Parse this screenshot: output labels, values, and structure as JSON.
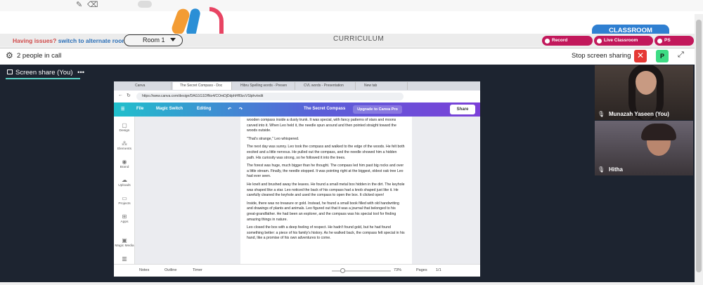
{
  "header": {
    "issue_text": "Having issues?",
    "issue_link": "switch to alternate room",
    "room": "Room 1",
    "curriculum": "CURRICULUM",
    "classroom_tab": "CLASSROOM",
    "pills": [
      "Record Classroom",
      "Live Classroom Support",
      "PS Moments"
    ]
  },
  "call": {
    "people": "2 people in call",
    "stop_share": "Stop screen sharing",
    "avatar_initial": "P",
    "close_symbol": "✕"
  },
  "stage": {
    "share_label": "Screen share (You)",
    "more": "•••"
  },
  "browser": {
    "tabs": [
      "Canva",
      "The Secret Compass - Doc",
      "Hibru Spelling words - Presen",
      "CVL words - Presentation",
      "New tab"
    ],
    "url": "https://www.canva.com/design/DAG1G1DfNo4/COmDjDdphHfI9zcVSlphv/edit"
  },
  "canva": {
    "file": "File",
    "magic_switch": "Magic Switch",
    "editing": "Editing",
    "doc_title": "The Secret Compass",
    "upgrade": "Upgrade to Canva Pro",
    "share": "Share",
    "sidebar": [
      "Design",
      "Elements",
      "Brand",
      "Uploads",
      "Projects",
      "Apps",
      "Magic Media",
      "Charts"
    ],
    "footer": {
      "notes": "Notes",
      "outline": "Outline",
      "timer": "Timer",
      "zoom": "73%",
      "pages": "Pages",
      "page_count": "1/1"
    }
  },
  "document": {
    "paragraphs": [
      "wooden compass inside a dusty trunk. It was special, with fancy patterns of stars and moons carved into it. When Leo held it, the needle spun around and then pointed straight toward the woods outside.",
      "\"That's strange,\" Leo whispered.",
      "The next day was sunny. Leo took the compass and walked to the edge of the woods. He felt both excited and a little nervous. He pulled out the compass, and the needle showed him a hidden path. His curiosity was strong, so he followed it into the trees.",
      "The forest was huge, much bigger than he thought. The compass led him past big rocks and over a little stream. Finally, the needle stopped. It was pointing right at the biggest, oldest oak tree Leo had ever seen.",
      "He knelt and brushed away the leaves. He found a small metal box hidden in the dirt. The keyhole was shaped like a star. Leo noticed the back of his compass had a knob shaped just like it. He carefully cleaned the keyhole and used the compass to open the box. It clicked open!",
      "Inside, there was no treasure or gold. Instead, he found a small book filled with old handwriting and drawings of plants and animals. Leo figured out that it was a journal that belonged to his great-grandfather. He had been an explorer, and the compass was his special tool for finding amazing things in nature.",
      "Leo closed the box with a deep feeling of respect. He hadn't found gold, but he had found something better: a piece of his family's history. As he walked back, the compass felt special in his hand, like a promise of his own adventures to come."
    ]
  },
  "participants": [
    {
      "name": "Munazah Yaseen (You)"
    },
    {
      "name": "Hitha"
    }
  ],
  "colors": {
    "accent_pink": "#c2185b",
    "classroom_blue": "#2f7fd1",
    "danger": "#e53935",
    "avatar_green": "#3ddc84",
    "stage_bg": "#1d2430"
  }
}
